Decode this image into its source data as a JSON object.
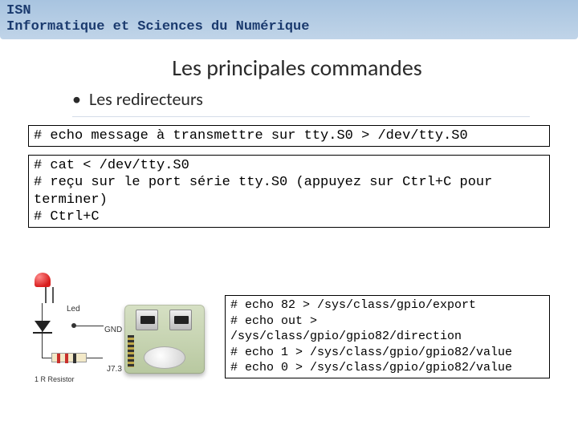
{
  "header": {
    "line1": "ISN",
    "line2": "Informatique et Sciences du Numérique"
  },
  "title": "Les principales commandes",
  "bullet": "Les redirecteurs",
  "code1": "# echo message à transmettre sur tty.S0 > /dev/tty.S0",
  "code2": "# cat < /dev/tty.S0\n# reçu sur le port série tty.S0 (appuyez sur Ctrl+C pour terminer)\n# Ctrl+C",
  "code3": "# echo 82 > /sys/class/gpio/export\n# echo out > /sys/class/gpio/gpio82/direction\n# echo 1 > /sys/class/gpio/gpio82/value\n# echo 0 > /sys/class/gpio/gpio82/value",
  "diagram": {
    "led_label": "Led",
    "gnd_label": "GND",
    "j73_label": "J7.3",
    "resistor_label": "1 R Resistor"
  }
}
